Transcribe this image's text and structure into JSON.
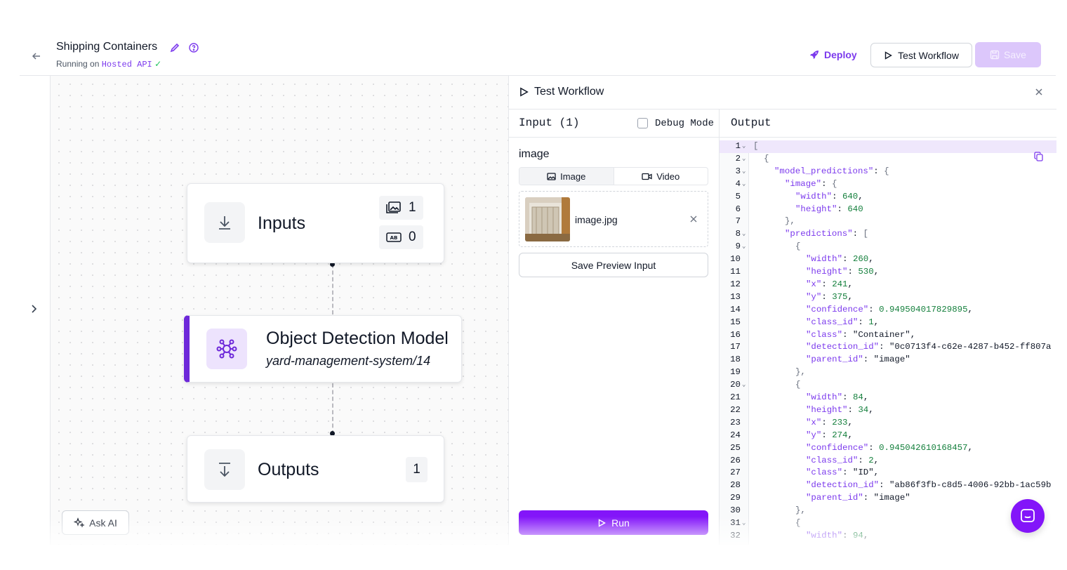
{
  "header": {
    "title": "Shipping Containers",
    "running_prefix": "Running on",
    "host": "Hosted API",
    "deploy_label": "Deploy",
    "test_label": "Test Workflow",
    "save_label": "Save"
  },
  "canvas": {
    "inputs": {
      "title": "Inputs",
      "image_count": "1",
      "text_count": "0"
    },
    "model": {
      "title": "Object Detection Model",
      "subtitle": "yard-management-system/14"
    },
    "outputs": {
      "title": "Outputs",
      "count": "1"
    },
    "ask_ai_label": "Ask AI"
  },
  "panel": {
    "title": "Test Workflow",
    "input_header": "Input (1)",
    "debug_label": "Debug Mode",
    "output_header": "Output",
    "image_field_label": "image",
    "tabs": [
      {
        "label": "Image"
      },
      {
        "label": "Video"
      }
    ],
    "file_name": "image.jpg",
    "save_preview_label": "Save Preview Input",
    "run_label": "Run"
  },
  "code_lines": [
    {
      "n": "1",
      "fold": true,
      "indent": 0,
      "tokens": [
        [
          "p",
          "["
        ]
      ]
    },
    {
      "n": "2",
      "fold": true,
      "indent": 1,
      "tokens": [
        [
          "p",
          "{"
        ]
      ]
    },
    {
      "n": "3",
      "fold": true,
      "indent": 2,
      "tokens": [
        [
          "k",
          "\"model_predictions\""
        ],
        [
          "s",
          ": "
        ],
        [
          "p",
          "{"
        ]
      ]
    },
    {
      "n": "4",
      "fold": true,
      "indent": 3,
      "tokens": [
        [
          "k",
          "\"image\""
        ],
        [
          "s",
          ": "
        ],
        [
          "p",
          "{"
        ]
      ]
    },
    {
      "n": "5",
      "fold": false,
      "indent": 4,
      "tokens": [
        [
          "k",
          "\"width\""
        ],
        [
          "s",
          ": "
        ],
        [
          "n",
          "640"
        ],
        [
          "s",
          ","
        ]
      ]
    },
    {
      "n": "6",
      "fold": false,
      "indent": 4,
      "tokens": [
        [
          "k",
          "\"height\""
        ],
        [
          "s",
          ": "
        ],
        [
          "n",
          "640"
        ]
      ]
    },
    {
      "n": "7",
      "fold": false,
      "indent": 3,
      "tokens": [
        [
          "p",
          "},"
        ]
      ]
    },
    {
      "n": "8",
      "fold": true,
      "indent": 3,
      "tokens": [
        [
          "k",
          "\"predictions\""
        ],
        [
          "s",
          ": "
        ],
        [
          "p",
          "["
        ]
      ]
    },
    {
      "n": "9",
      "fold": true,
      "indent": 4,
      "tokens": [
        [
          "p",
          "{"
        ]
      ]
    },
    {
      "n": "10",
      "fold": false,
      "indent": 5,
      "tokens": [
        [
          "k",
          "\"width\""
        ],
        [
          "s",
          ": "
        ],
        [
          "n",
          "260"
        ],
        [
          "s",
          ","
        ]
      ]
    },
    {
      "n": "11",
      "fold": false,
      "indent": 5,
      "tokens": [
        [
          "k",
          "\"height\""
        ],
        [
          "s",
          ": "
        ],
        [
          "n",
          "530"
        ],
        [
          "s",
          ","
        ]
      ]
    },
    {
      "n": "12",
      "fold": false,
      "indent": 5,
      "tokens": [
        [
          "k",
          "\"x\""
        ],
        [
          "s",
          ": "
        ],
        [
          "n",
          "241"
        ],
        [
          "s",
          ","
        ]
      ]
    },
    {
      "n": "13",
      "fold": false,
      "indent": 5,
      "tokens": [
        [
          "k",
          "\"y\""
        ],
        [
          "s",
          ": "
        ],
        [
          "n",
          "375"
        ],
        [
          "s",
          ","
        ]
      ]
    },
    {
      "n": "14",
      "fold": false,
      "indent": 5,
      "tokens": [
        [
          "k",
          "\"confidence\""
        ],
        [
          "s",
          ": "
        ],
        [
          "n",
          "0.949504017829895"
        ],
        [
          "s",
          ","
        ]
      ]
    },
    {
      "n": "15",
      "fold": false,
      "indent": 5,
      "tokens": [
        [
          "k",
          "\"class_id\""
        ],
        [
          "s",
          ": "
        ],
        [
          "n",
          "1"
        ],
        [
          "s",
          ","
        ]
      ]
    },
    {
      "n": "16",
      "fold": false,
      "indent": 5,
      "tokens": [
        [
          "k",
          "\"class\""
        ],
        [
          "s",
          ": \"Container\","
        ]
      ]
    },
    {
      "n": "17",
      "fold": false,
      "indent": 5,
      "tokens": [
        [
          "k",
          "\"detection_id\""
        ],
        [
          "s",
          ": \"0c0713f4-c62e-4287-b452-ff807a"
        ]
      ]
    },
    {
      "n": "18",
      "fold": false,
      "indent": 5,
      "tokens": [
        [
          "k",
          "\"parent_id\""
        ],
        [
          "s",
          ": \"image\""
        ]
      ]
    },
    {
      "n": "19",
      "fold": false,
      "indent": 4,
      "tokens": [
        [
          "p",
          "},"
        ]
      ]
    },
    {
      "n": "20",
      "fold": true,
      "indent": 4,
      "tokens": [
        [
          "p",
          "{"
        ]
      ]
    },
    {
      "n": "21",
      "fold": false,
      "indent": 5,
      "tokens": [
        [
          "k",
          "\"width\""
        ],
        [
          "s",
          ": "
        ],
        [
          "n",
          "84"
        ],
        [
          "s",
          ","
        ]
      ]
    },
    {
      "n": "22",
      "fold": false,
      "indent": 5,
      "tokens": [
        [
          "k",
          "\"height\""
        ],
        [
          "s",
          ": "
        ],
        [
          "n",
          "34"
        ],
        [
          "s",
          ","
        ]
      ]
    },
    {
      "n": "23",
      "fold": false,
      "indent": 5,
      "tokens": [
        [
          "k",
          "\"x\""
        ],
        [
          "s",
          ": "
        ],
        [
          "n",
          "233"
        ],
        [
          "s",
          ","
        ]
      ]
    },
    {
      "n": "24",
      "fold": false,
      "indent": 5,
      "tokens": [
        [
          "k",
          "\"y\""
        ],
        [
          "s",
          ": "
        ],
        [
          "n",
          "274"
        ],
        [
          "s",
          ","
        ]
      ]
    },
    {
      "n": "25",
      "fold": false,
      "indent": 5,
      "tokens": [
        [
          "k",
          "\"confidence\""
        ],
        [
          "s",
          ": "
        ],
        [
          "n",
          "0.945042610168457"
        ],
        [
          "s",
          ","
        ]
      ]
    },
    {
      "n": "26",
      "fold": false,
      "indent": 5,
      "tokens": [
        [
          "k",
          "\"class_id\""
        ],
        [
          "s",
          ": "
        ],
        [
          "n",
          "2"
        ],
        [
          "s",
          ","
        ]
      ]
    },
    {
      "n": "27",
      "fold": false,
      "indent": 5,
      "tokens": [
        [
          "k",
          "\"class\""
        ],
        [
          "s",
          ": \"ID\","
        ]
      ]
    },
    {
      "n": "28",
      "fold": false,
      "indent": 5,
      "tokens": [
        [
          "k",
          "\"detection_id\""
        ],
        [
          "s",
          ": \"ab86f3fb-c8d5-4006-92bb-1ac59b"
        ]
      ]
    },
    {
      "n": "29",
      "fold": false,
      "indent": 5,
      "tokens": [
        [
          "k",
          "\"parent_id\""
        ],
        [
          "s",
          ": \"image\""
        ]
      ]
    },
    {
      "n": "30",
      "fold": false,
      "indent": 4,
      "tokens": [
        [
          "p",
          "},"
        ]
      ]
    },
    {
      "n": "31",
      "fold": true,
      "indent": 4,
      "tokens": [
        [
          "p",
          "{"
        ]
      ]
    },
    {
      "n": "32",
      "fold": false,
      "indent": 5,
      "tokens": [
        [
          "k",
          "\"width\""
        ],
        [
          "s",
          ": "
        ],
        [
          "n",
          "94"
        ],
        [
          "s",
          ","
        ]
      ]
    }
  ],
  "colors": {
    "accent": "#8315f9",
    "brand_purple": "#7c3aed",
    "model_bar": "#6d28d9",
    "json_key": "#7c3aed",
    "json_number": "#15803d"
  }
}
